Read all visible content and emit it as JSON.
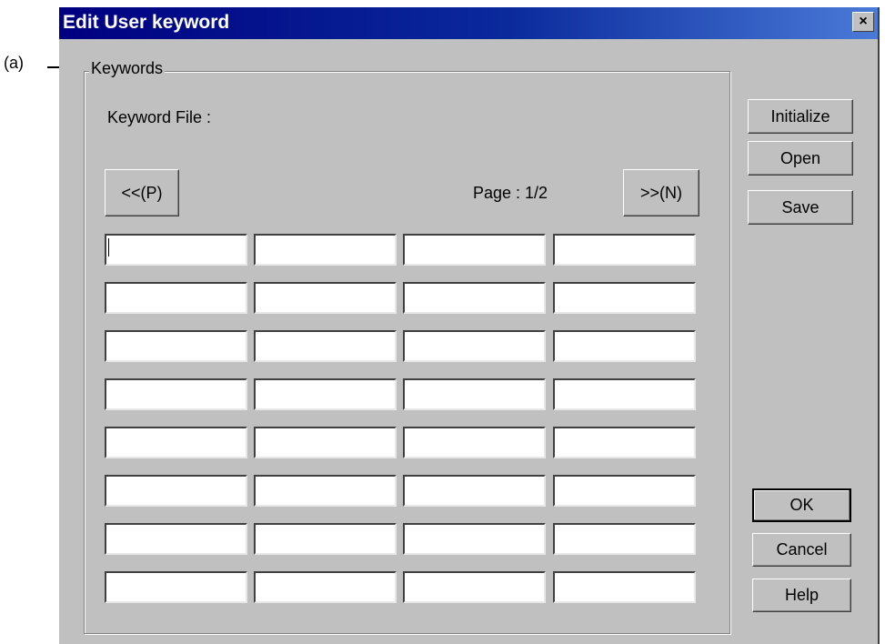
{
  "annotation": {
    "label": "(a)"
  },
  "window": {
    "title": "Edit User keyword",
    "close_label": "×"
  },
  "keywords_group": {
    "legend": "Keywords",
    "keyword_file_label": "Keyword File :",
    "keyword_file_value": "",
    "prev_button": "<<(P)",
    "next_button": ">>(N)",
    "page_label": "Page : 1/2",
    "rows": [
      [
        "",
        "",
        "",
        ""
      ],
      [
        "",
        "",
        "",
        ""
      ],
      [
        "",
        "",
        "",
        ""
      ],
      [
        "",
        "",
        "",
        ""
      ],
      [
        "",
        "",
        "",
        ""
      ],
      [
        "",
        "",
        "",
        ""
      ],
      [
        "",
        "",
        "",
        ""
      ],
      [
        "",
        "",
        "",
        ""
      ]
    ]
  },
  "side_buttons": {
    "initialize": "Initialize",
    "open": "Open",
    "save": "Save"
  },
  "bottom_buttons": {
    "ok": "OK",
    "cancel": "Cancel",
    "help": "Help"
  },
  "colors": {
    "titlebar_start": "#000080",
    "titlebar_end": "#4a7ad8",
    "face": "#c0c0c0"
  }
}
